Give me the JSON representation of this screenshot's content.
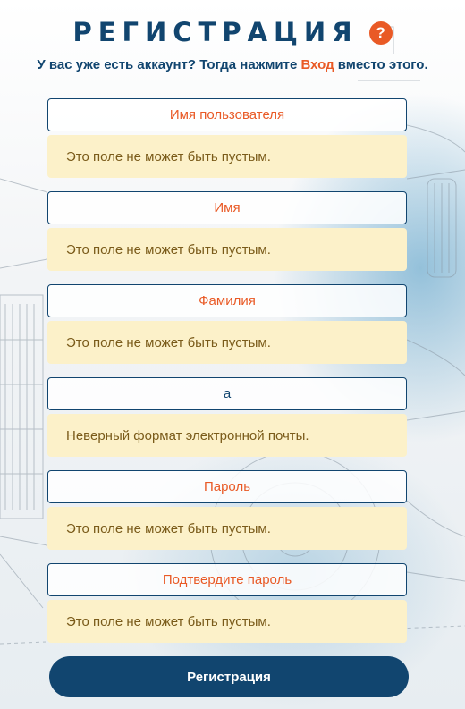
{
  "header": {
    "title": "РЕГИСТРАЦИЯ",
    "help_icon": "?",
    "subtitle_before": "У вас уже есть аккаунт? Тогда нажмите ",
    "login_link": "Вход",
    "subtitle_after": " вместо этого."
  },
  "fields": [
    {
      "placeholder": "Имя пользователя",
      "value": "",
      "error": "Это поле не может быть пустым."
    },
    {
      "placeholder": "Имя",
      "value": "",
      "error": "Это поле не может быть пустым."
    },
    {
      "placeholder": "Фамилия",
      "value": "",
      "error": "Это поле не может быть пустым."
    },
    {
      "placeholder": "",
      "value": "a",
      "error": "Неверный формат электронной почты."
    },
    {
      "placeholder": "Пароль",
      "value": "",
      "error": "Это поле не может быть пустым."
    },
    {
      "placeholder": "Подтвердите пароль",
      "value": "",
      "error": "Это поле не может быть пустым."
    }
  ],
  "submit_label": "Регистрация",
  "colors": {
    "primary": "#11456f",
    "accent": "#e95a26",
    "error_bg": "#fcf1c9",
    "error_text": "#7a5b1a"
  }
}
